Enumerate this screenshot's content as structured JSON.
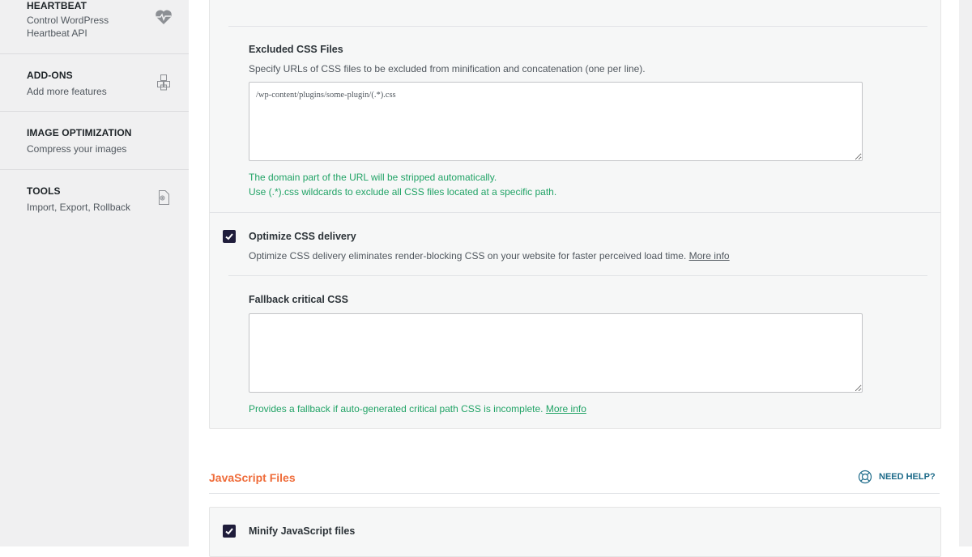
{
  "sidebar": {
    "items": [
      {
        "title": "HEARTBEAT",
        "desc": "Control WordPress Heartbeat API",
        "icon": "heartbeat-icon"
      },
      {
        "title": "ADD-ONS",
        "desc": "Add more features",
        "icon": "addons-cubes-icon"
      },
      {
        "title": "IMAGE OPTIMIZATION",
        "desc": "Compress your images",
        "icon": ""
      },
      {
        "title": "TOOLS",
        "desc": "Import, Export, Rollback",
        "icon": "tools-file-gear-icon"
      }
    ]
  },
  "css_panel": {
    "excluded": {
      "title": "Excluded CSS Files",
      "desc": "Specify URLs of CSS files to be excluded from minification and concatenation (one per line).",
      "value": "/wp-content/plugins/some-plugin/(.*).css",
      "note1": "The domain part of the URL will be stripped automatically.",
      "note2": "Use (.*).css wildcards to exclude all CSS files located at a specific path."
    },
    "optimize": {
      "label": "Optimize CSS delivery",
      "checked": true,
      "desc": "Optimize CSS delivery eliminates render-blocking CSS on your website for faster perceived load time.",
      "more_info": "More info"
    },
    "fallback": {
      "title": "Fallback critical CSS",
      "value": "",
      "note": "Provides a fallback if auto-generated critical path CSS is incomplete.",
      "more_info": "More info"
    }
  },
  "js_section": {
    "title": "JavaScript Files",
    "help": "NEED HELP?",
    "minify": {
      "label": "Minify JavaScript files",
      "checked": true
    }
  },
  "colors": {
    "accent_orange": "#ef6c3a",
    "note_green": "#21a366",
    "checkbox_dark": "#1f1d3b",
    "help_teal": "#1e6b8a"
  }
}
